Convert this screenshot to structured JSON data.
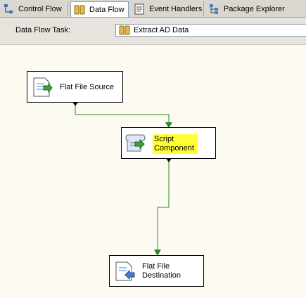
{
  "tabs": [
    {
      "label": "Control Flow",
      "icon": "control-flow-icon",
      "active": false
    },
    {
      "label": "Data Flow",
      "icon": "data-flow-icon",
      "active": true
    },
    {
      "label": "Event Handlers",
      "icon": "event-handlers-icon",
      "active": false
    },
    {
      "label": "Package Explorer",
      "icon": "package-explorer-icon",
      "active": false
    }
  ],
  "task": {
    "label": "Data Flow Task:",
    "selected": "Extract AD Data"
  },
  "nodes": {
    "source": {
      "label": "Flat File Source",
      "icon": "flat-file-source-icon"
    },
    "script": {
      "line1": "Script",
      "line2": "Component",
      "icon": "script-component-icon",
      "highlight": "#ffff33"
    },
    "destination": {
      "line1": "Flat File",
      "line2": "Destination",
      "icon": "flat-file-destination-icon"
    }
  },
  "colors": {
    "path": "#1f8a1f",
    "highlight": "#ffff33",
    "canvas": "#fdfbf1"
  }
}
